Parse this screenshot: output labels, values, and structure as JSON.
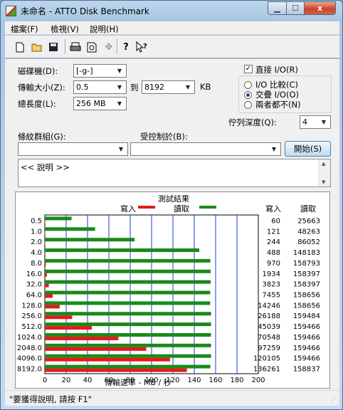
{
  "window": {
    "title": "未命名 - ATTO Disk Benchmark",
    "close_glyph": "x"
  },
  "menu": {
    "file": "檔案(F)",
    "view": "檢視(V)",
    "help": "說明(H)"
  },
  "toolbar": {
    "icons": [
      "new-icon",
      "open-icon",
      "save-icon",
      "print-icon",
      "print-preview-icon",
      "move-icon",
      "help-icon",
      "context-help-icon"
    ]
  },
  "form": {
    "drive_label": "磁碟機(D):",
    "drive_value": "[-g-]",
    "transfer_label": "傳輸大小(Z):",
    "transfer_from": "0.5",
    "transfer_to_label": "到",
    "transfer_to": "8192",
    "transfer_unit": "KB",
    "length_label": "總長度(L):",
    "length_value": "256 MB",
    "direct_io_label": "直接 I/O(R)",
    "direct_io_checked": true,
    "io_compare_label": "I/O 比較(C)",
    "overlap_io_label": "交疊 I/O(O)",
    "neither_label": "兩者都不(N)",
    "queue_label": "佇列深度(Q):",
    "queue_value": "4",
    "pattern_label": "條紋群組(G):",
    "pattern_value": "",
    "controlled_label": "受控制於(B):",
    "controlled_value": "",
    "start_button": "開始(S)",
    "log_text": "<< 說明 >>"
  },
  "chart_data": {
    "type": "bar",
    "title": "測試結果",
    "legend_write": "寫入",
    "legend_read": "讀取",
    "col_write": "寫入",
    "col_read": "讀取",
    "xlabel": "傳輸速率 - MB / 秒",
    "xlim": [
      0,
      200
    ],
    "xticks": [
      "0",
      "20",
      "40",
      "60",
      "80",
      "100",
      "120",
      "140",
      "160",
      "180",
      "200"
    ],
    "categories": [
      "0.5",
      "1.0",
      "2.0",
      "4.0",
      "8.0",
      "16.0",
      "32.0",
      "64.0",
      "128.0",
      "256.0",
      "512.0",
      "1024.0",
      "2048.0",
      "4096.0",
      "8192.0"
    ],
    "series": [
      {
        "name": "寫入",
        "color": "#e31b1b",
        "values": [
          0.06,
          0.12,
          0.24,
          0.48,
          0.95,
          1.89,
          3.73,
          7.28,
          13.91,
          25.57,
          43.98,
          68.92,
          94.98,
          117.3,
          133.07
        ]
      },
      {
        "name": "讀取",
        "color": "#1a8a1a",
        "values": [
          25.06,
          47.13,
          84.04,
          144.69,
          155.07,
          155.36,
          155.36,
          154.94,
          154.94,
          155.75,
          155.73,
          155.73,
          155.73,
          155.73,
          155.11
        ]
      }
    ],
    "write_kb": [
      "60",
      "121",
      "244",
      "488",
      "970",
      "1934",
      "3823",
      "7455",
      "14246",
      "26188",
      "45039",
      "70548",
      "97259",
      "120105",
      "136261"
    ],
    "read_kb": [
      "25663",
      "48263",
      "86052",
      "148183",
      "158793",
      "158397",
      "158397",
      "158656",
      "158656",
      "159484",
      "159466",
      "159466",
      "159466",
      "159466",
      "158837"
    ]
  },
  "status": {
    "text": "\"要獲得說明, 請按 F1\""
  }
}
